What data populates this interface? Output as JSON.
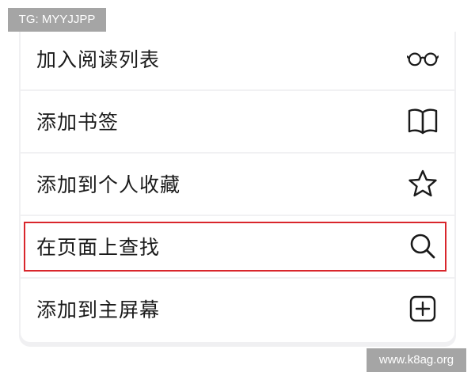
{
  "watermarks": {
    "top_left": "TG: MYYJJPP",
    "bottom_right": "www.k8ag.org"
  },
  "menu": {
    "items": [
      {
        "label": "加入阅读列表",
        "icon": "glasses-icon"
      },
      {
        "label": "添加书签",
        "icon": "book-icon"
      },
      {
        "label": "添加到个人收藏",
        "icon": "star-icon"
      },
      {
        "label": "在页面上查找",
        "icon": "search-icon",
        "highlighted": true
      },
      {
        "label": "添加到主屏幕",
        "icon": "add-square-icon"
      }
    ]
  },
  "colors": {
    "highlight_border": "#d9262c",
    "icon_stroke": "#1a1a1a",
    "divider": "#f1f1f3",
    "watermark_bg": "#a5a5a5"
  }
}
